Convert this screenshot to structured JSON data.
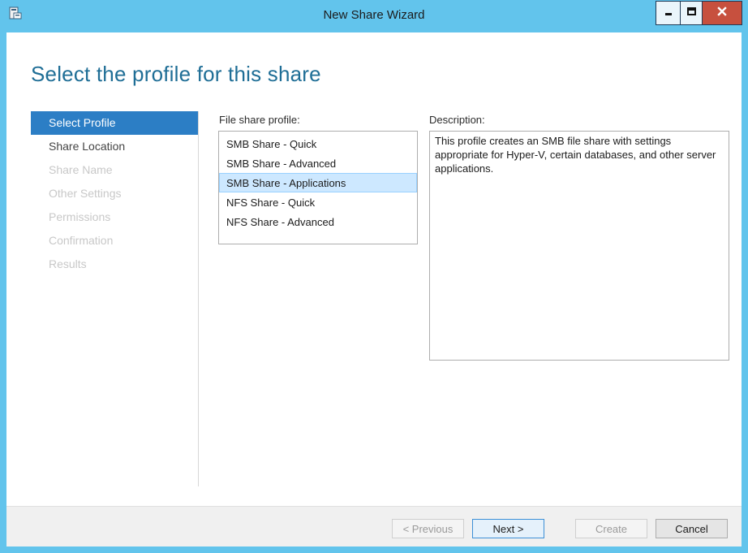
{
  "window": {
    "title": "New Share Wizard",
    "accent_color": "#62c4ec",
    "close_color": "#c7503e"
  },
  "page_heading": "Select the profile for this share",
  "nav": {
    "items": [
      {
        "label": "Select Profile",
        "state": "active"
      },
      {
        "label": "Share Location",
        "state": "enabled"
      },
      {
        "label": "Share Name",
        "state": "disabled"
      },
      {
        "label": "Other Settings",
        "state": "disabled"
      },
      {
        "label": "Permissions",
        "state": "disabled"
      },
      {
        "label": "Confirmation",
        "state": "disabled"
      },
      {
        "label": "Results",
        "state": "disabled"
      }
    ]
  },
  "profile_section": {
    "label": "File share profile:",
    "items": [
      {
        "label": "SMB Share - Quick",
        "selected": false
      },
      {
        "label": "SMB Share - Advanced",
        "selected": false
      },
      {
        "label": "SMB Share - Applications",
        "selected": true
      },
      {
        "label": "NFS Share - Quick",
        "selected": false
      },
      {
        "label": "NFS Share - Advanced",
        "selected": false
      }
    ]
  },
  "description_section": {
    "label": "Description:",
    "text": "This profile creates an SMB file share with settings appropriate for Hyper-V, certain databases, and other server applications."
  },
  "footer": {
    "previous_label": "< Previous",
    "next_label": "Next >",
    "create_label": "Create",
    "cancel_label": "Cancel"
  },
  "icons": {
    "app": "share-wizard-icon",
    "minimize": "minimize-icon",
    "maximize": "maximize-icon",
    "close": "close-icon"
  }
}
